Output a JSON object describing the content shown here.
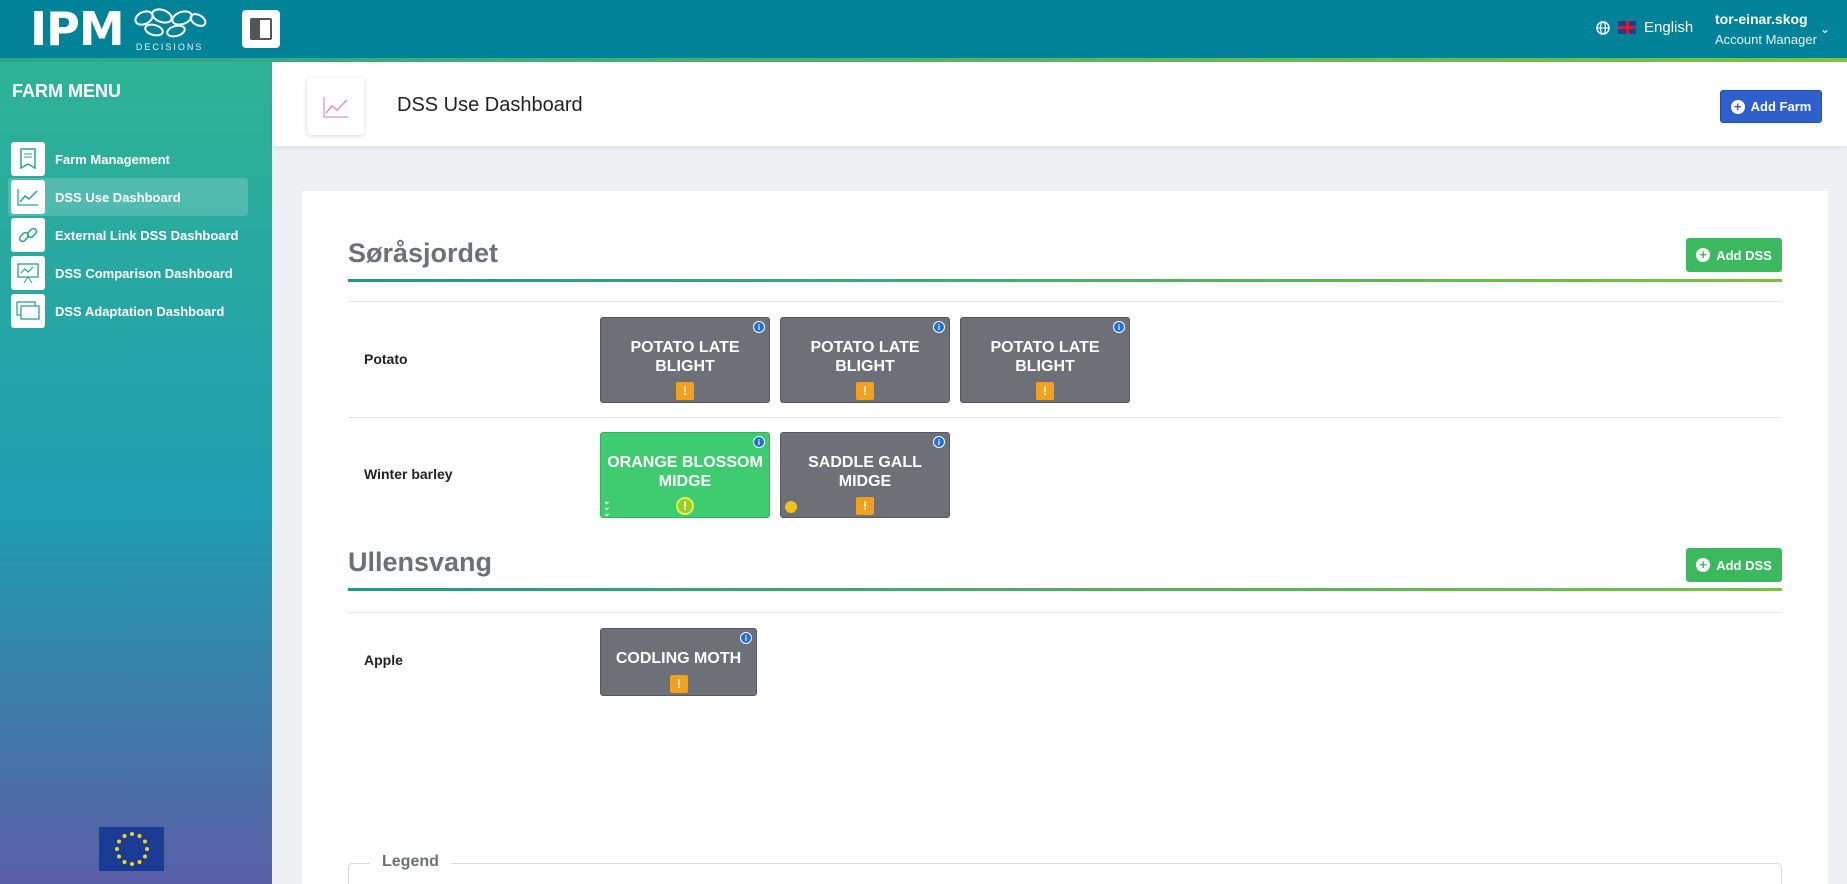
{
  "topbar": {
    "logo_text": "IPM",
    "logo_sub": "DECISIONS",
    "language": "English",
    "user_name": "tor-einar.skog",
    "user_role": "Account Manager"
  },
  "sidebar": {
    "title": "FARM MENU",
    "items": [
      {
        "label": "Farm Management",
        "icon": "bookmark-icon"
      },
      {
        "label": "DSS Use Dashboard",
        "icon": "line-chart-icon"
      },
      {
        "label": "External Link DSS Dashboard",
        "icon": "link-icon"
      },
      {
        "label": "DSS Comparison Dashboard",
        "icon": "presentation-icon"
      },
      {
        "label": "DSS Adaptation Dashboard",
        "icon": "windows-icon"
      }
    ]
  },
  "header": {
    "title": "DSS Use Dashboard",
    "add_farm": "Add Farm"
  },
  "farms": [
    {
      "name": "Søråsjordet",
      "add_dss": "Add DSS",
      "crops": [
        {
          "name": "Potato",
          "dss": [
            "POTATO LATE BLIGHT",
            "POTATO LATE BLIGHT",
            "POTATO LATE BLIGHT"
          ]
        },
        {
          "name": "Winter barley",
          "dss": [
            "ORANGE BLOSSOM MIDGE",
            "SADDLE GALL MIDGE"
          ]
        }
      ]
    },
    {
      "name": "Ullensvang",
      "add_dss": "Add DSS",
      "crops": [
        {
          "name": "Apple",
          "dss": [
            "CODLING MOTH"
          ]
        }
      ]
    }
  ],
  "legend": {
    "title": "Legend"
  },
  "colors": {
    "topbar": "#008299",
    "primary_button": "#2e5fcc",
    "add_dss_button": "#3cb85e",
    "tile_grey": "#6d7177",
    "tile_green": "#3fcb6f",
    "warning": "#f3a01d"
  }
}
